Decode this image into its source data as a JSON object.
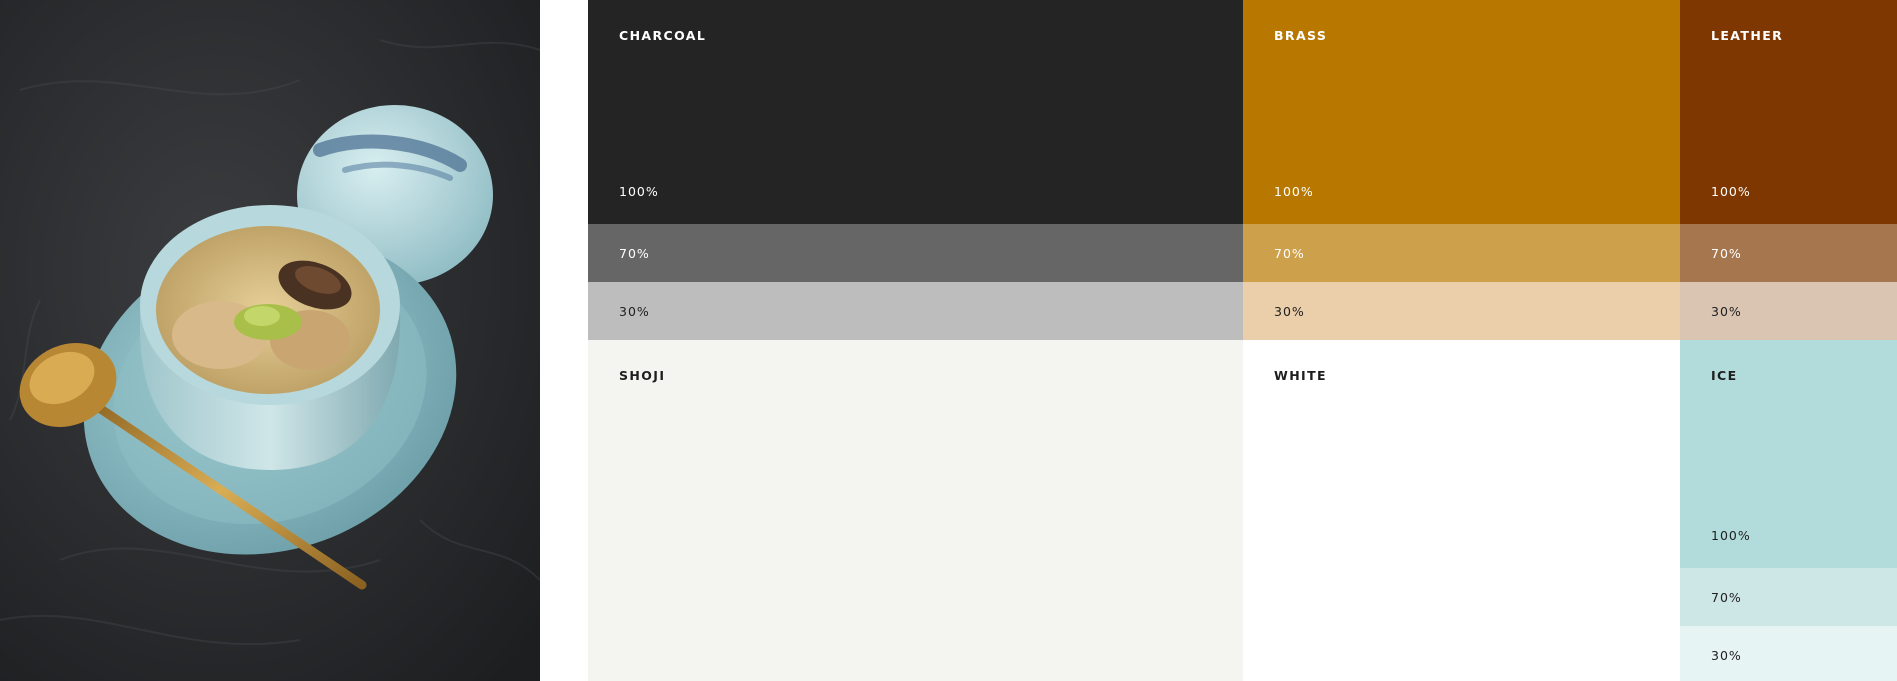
{
  "palette": {
    "charcoal": {
      "name": "CHARCOAL",
      "shades": [
        {
          "label": "100%",
          "color": "#242424"
        },
        {
          "label": "70%",
          "color": "#666666"
        },
        {
          "label": "30%",
          "color": "#bdbdbd"
        }
      ]
    },
    "brass": {
      "name": "BRASS",
      "shades": [
        {
          "label": "100%",
          "color": "#b87800"
        },
        {
          "label": "70%",
          "color": "#cda04c"
        },
        {
          "label": "30%",
          "color": "#eacfaa"
        }
      ]
    },
    "leather": {
      "name": "LEATHER",
      "shades": [
        {
          "label": "100%",
          "color": "#7e3700"
        },
        {
          "label": "70%",
          "color": "#a6764e"
        },
        {
          "label": "30%",
          "color": "#dac4b2"
        }
      ]
    },
    "shoji": {
      "name": "SHOJI",
      "color": "#f4f4f0"
    },
    "white": {
      "name": "WHITE",
      "color": "#ffffff"
    },
    "ice": {
      "name": "ICE",
      "shades": [
        {
          "label": "100%",
          "color": "#b1dcdb"
        },
        {
          "label": "70%",
          "color": "#cde7e7"
        },
        {
          "label": "30%",
          "color": "#e7f4f4"
        }
      ]
    }
  },
  "photo": {
    "icon": "chawanmushi-photo-icon",
    "background_color": "#2c2d2f",
    "ceramic_color": "#a8d0d6",
    "spoon_color": "#c2933c"
  }
}
